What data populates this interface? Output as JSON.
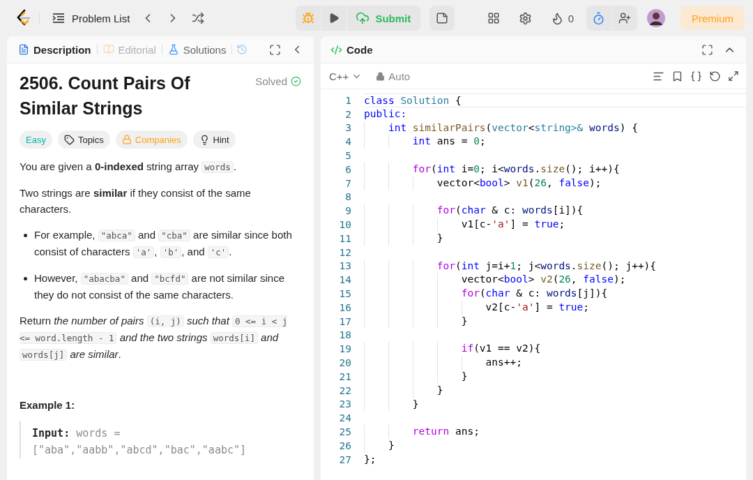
{
  "topbar": {
    "problem_list": "Problem List",
    "submit": "Submit",
    "streak": "0",
    "premium": "Premium"
  },
  "description_panel": {
    "tabs": [
      {
        "label": "Description",
        "kind": "description",
        "selected": true,
        "disabled": false
      },
      {
        "label": "Editorial",
        "kind": "editorial",
        "selected": false,
        "disabled": true
      },
      {
        "label": "Solutions",
        "kind": "solutions",
        "selected": false,
        "disabled": false
      }
    ],
    "title": "2506. Count Pairs Of Similar Strings",
    "status": "Solved",
    "tags": [
      {
        "label": "Easy",
        "kind": "difficulty"
      },
      {
        "label": "Topics",
        "kind": "topics"
      },
      {
        "label": "Companies",
        "kind": "companies"
      },
      {
        "label": "Hint",
        "kind": "hint"
      }
    ],
    "blocks": [
      {
        "kind": "paragraph",
        "segments": [
          {
            "kind": "text",
            "text": "You are given a **0-indexed** string array "
          },
          {
            "kind": "code",
            "text": "words"
          },
          {
            "kind": "text",
            "text": "."
          }
        ]
      },
      {
        "kind": "paragraph",
        "segments": [
          {
            "kind": "text",
            "text": "Two strings are **similar** if they consist of the same characters."
          }
        ]
      },
      {
        "kind": "bullets",
        "items": [
          {
            "segments": [
              {
                "kind": "text",
                "text": "For example, "
              },
              {
                "kind": "code",
                "text": "\"abca\""
              },
              {
                "kind": "text",
                "text": " and "
              },
              {
                "kind": "code",
                "text": "\"cba\""
              },
              {
                "kind": "text",
                "text": " are similar since both consist of characters "
              },
              {
                "kind": "code",
                "text": "'a'"
              },
              {
                "kind": "text",
                "text": ", "
              },
              {
                "kind": "code",
                "text": "'b'"
              },
              {
                "kind": "text",
                "text": ", and "
              },
              {
                "kind": "code",
                "text": "'c'"
              },
              {
                "kind": "text",
                "text": "."
              }
            ]
          },
          {
            "segments": [
              {
                "kind": "text",
                "text": "However, "
              },
              {
                "kind": "code",
                "text": "\"abacba\""
              },
              {
                "kind": "text",
                "text": " and "
              },
              {
                "kind": "code",
                "text": "\"bcfd\""
              },
              {
                "kind": "text",
                "text": " are not similar since they do not consist of the same characters."
              }
            ]
          }
        ]
      },
      {
        "kind": "paragraph",
        "segments": [
          {
            "kind": "text",
            "text": "Return *the number of pairs* "
          },
          {
            "kind": "code",
            "text": "(i, j)"
          },
          {
            "kind": "text",
            "text": " *such that* "
          },
          {
            "kind": "code",
            "text": "0 <= i < j <= word.length - 1"
          },
          {
            "kind": "text",
            "text": " *and the two strings* "
          },
          {
            "kind": "code",
            "text": "words[i]"
          },
          {
            "kind": "text",
            "text": " *and* "
          },
          {
            "kind": "code",
            "text": "words[j]"
          },
          {
            "kind": "text",
            "text": " *are similar*."
          }
        ]
      },
      {
        "kind": "heading",
        "text": "Example 1:"
      },
      {
        "kind": "example",
        "label": "Input:",
        "text": "words = [\"aba\",\"aabb\",\"abcd\",\"bac\",\"aabc\"]"
      }
    ]
  },
  "code_panel": {
    "title": "Code",
    "language": "C++",
    "mode": "Auto",
    "lines": [
      {
        "number": "1",
        "current": true,
        "tokens": [
          {
            "kind": "keyword",
            "text": "class"
          },
          {
            "kind": "type",
            "text": " Solution"
          },
          {
            "kind": "plain",
            "text": " {"
          }
        ]
      },
      {
        "number": "2",
        "current": false,
        "tokens": [
          {
            "kind": "keyword",
            "text": "public:"
          }
        ]
      },
      {
        "number": "3",
        "current": false,
        "tokens": [
          {
            "kind": "keyword",
            "text": "    int"
          },
          {
            "kind": "function",
            "text": " similarPairs"
          },
          {
            "kind": "plain",
            "text": "("
          },
          {
            "kind": "type",
            "text": "vector"
          },
          {
            "kind": "plain",
            "text": "<"
          },
          {
            "kind": "type",
            "text": "string"
          },
          {
            "kind": "type",
            "text": ">& "
          },
          {
            "kind": "variable",
            "text": "words"
          },
          {
            "kind": "plain",
            "text": ") {"
          }
        ]
      },
      {
        "number": "4",
        "current": false,
        "tokens": [
          {
            "kind": "keyword",
            "text": "        int"
          },
          {
            "kind": "plain",
            "text": " ans = "
          },
          {
            "kind": "number",
            "text": "0"
          },
          {
            "kind": "plain",
            "text": ";"
          }
        ]
      },
      {
        "number": "5",
        "current": false
      },
      {
        "number": "6",
        "current": false,
        "tokens": [
          {
            "kind": "control",
            "text": "        for"
          },
          {
            "kind": "plain",
            "text": "("
          },
          {
            "kind": "keyword",
            "text": "int"
          },
          {
            "kind": "plain",
            "text": " i="
          },
          {
            "kind": "number",
            "text": "0"
          },
          {
            "kind": "plain",
            "text": "; i<"
          },
          {
            "kind": "variable",
            "text": "words"
          },
          {
            "kind": "plain",
            "text": "."
          },
          {
            "kind": "function",
            "text": "size"
          },
          {
            "kind": "plain",
            "text": "(); i++){"
          }
        ]
      },
      {
        "number": "7",
        "current": false,
        "tokens": [
          {
            "kind": "plain",
            "text": "            vector<"
          },
          {
            "kind": "keyword",
            "text": "bool"
          },
          {
            "kind": "plain",
            "text": "> "
          },
          {
            "kind": "function",
            "text": "v1"
          },
          {
            "kind": "plain",
            "text": "("
          },
          {
            "kind": "number",
            "text": "26"
          },
          {
            "kind": "plain",
            "text": ", "
          },
          {
            "kind": "keyword",
            "text": "false"
          },
          {
            "kind": "plain",
            "text": ");"
          }
        ]
      },
      {
        "number": "8",
        "current": false
      },
      {
        "number": "9",
        "current": false,
        "tokens": [
          {
            "kind": "control",
            "text": "            for"
          },
          {
            "kind": "plain",
            "text": "("
          },
          {
            "kind": "keyword",
            "text": "char"
          },
          {
            "kind": "plain",
            "text": " & c: "
          },
          {
            "kind": "variable",
            "text": "words"
          },
          {
            "kind": "plain",
            "text": "[i]){"
          }
        ]
      },
      {
        "number": "10",
        "current": false,
        "tokens": [
          {
            "kind": "plain",
            "text": "                v1[c-"
          },
          {
            "kind": "string",
            "text": "'a'"
          },
          {
            "kind": "plain",
            "text": "] = "
          },
          {
            "kind": "keyword",
            "text": "true"
          },
          {
            "kind": "plain",
            "text": ";"
          }
        ]
      },
      {
        "number": "11",
        "current": false,
        "tokens": [
          {
            "kind": "plain",
            "text": "            }"
          }
        ]
      },
      {
        "number": "12",
        "current": false
      },
      {
        "number": "13",
        "current": false,
        "tokens": [
          {
            "kind": "control",
            "text": "            for"
          },
          {
            "kind": "plain",
            "text": "("
          },
          {
            "kind": "keyword",
            "text": "int"
          },
          {
            "kind": "plain",
            "text": " j=i+"
          },
          {
            "kind": "number",
            "text": "1"
          },
          {
            "kind": "plain",
            "text": "; j<"
          },
          {
            "kind": "variable",
            "text": "words"
          },
          {
            "kind": "plain",
            "text": "."
          },
          {
            "kind": "function",
            "text": "size"
          },
          {
            "kind": "plain",
            "text": "(); j++){"
          }
        ]
      },
      {
        "number": "14",
        "current": false,
        "tokens": [
          {
            "kind": "plain",
            "text": "                vector<"
          },
          {
            "kind": "keyword",
            "text": "bool"
          },
          {
            "kind": "plain",
            "text": "> "
          },
          {
            "kind": "function",
            "text": "v2"
          },
          {
            "kind": "plain",
            "text": "("
          },
          {
            "kind": "number",
            "text": "26"
          },
          {
            "kind": "plain",
            "text": ", "
          },
          {
            "kind": "keyword",
            "text": "false"
          },
          {
            "kind": "plain",
            "text": ");"
          }
        ]
      },
      {
        "number": "15",
        "current": false,
        "tokens": [
          {
            "kind": "control",
            "text": "                for"
          },
          {
            "kind": "plain",
            "text": "("
          },
          {
            "kind": "keyword",
            "text": "char"
          },
          {
            "kind": "plain",
            "text": " & c: "
          },
          {
            "kind": "variable",
            "text": "words"
          },
          {
            "kind": "plain",
            "text": "[j]){"
          }
        ]
      },
      {
        "number": "16",
        "current": false,
        "tokens": [
          {
            "kind": "plain",
            "text": "                    v2[c-"
          },
          {
            "kind": "string",
            "text": "'a'"
          },
          {
            "kind": "plain",
            "text": "] = "
          },
          {
            "kind": "keyword",
            "text": "true"
          },
          {
            "kind": "plain",
            "text": ";"
          }
        ]
      },
      {
        "number": "17",
        "current": false,
        "tokens": [
          {
            "kind": "plain",
            "text": "                }"
          }
        ]
      },
      {
        "number": "18",
        "current": false
      },
      {
        "number": "19",
        "current": false,
        "tokens": [
          {
            "kind": "control",
            "text": "                if"
          },
          {
            "kind": "plain",
            "text": "(v1 == v2){"
          }
        ]
      },
      {
        "number": "20",
        "current": false,
        "tokens": [
          {
            "kind": "plain",
            "text": "                    ans++;"
          }
        ]
      },
      {
        "number": "21",
        "current": false,
        "tokens": [
          {
            "kind": "plain",
            "text": "                }"
          }
        ]
      },
      {
        "number": "22",
        "current": false,
        "tokens": [
          {
            "kind": "plain",
            "text": "            }"
          }
        ]
      },
      {
        "number": "23",
        "current": false,
        "tokens": [
          {
            "kind": "plain",
            "text": "        }"
          }
        ]
      },
      {
        "number": "24",
        "current": false
      },
      {
        "number": "25",
        "current": false,
        "tokens": [
          {
            "kind": "control",
            "text": "        return"
          },
          {
            "kind": "plain",
            "text": " ans;"
          }
        ]
      },
      {
        "number": "26",
        "current": false,
        "tokens": [
          {
            "kind": "plain",
            "text": "    }"
          }
        ]
      },
      {
        "number": "27",
        "current": false,
        "tokens": [
          {
            "kind": "plain",
            "text": "};"
          }
        ]
      }
    ]
  }
}
